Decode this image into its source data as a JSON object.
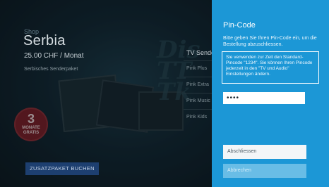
{
  "background": {
    "shop_label": "Shop",
    "title": "Serbia",
    "price": "25.00 CHF / Monat",
    "description": "Serbisches Senderpaket",
    "promo_badge": {
      "number": "3",
      "line1": "MONATE",
      "line2": "GRATIS"
    },
    "channel_list": {
      "header": "TV Sender",
      "items": [
        "Pink Plus",
        "Pink Extra",
        "Pink Music",
        "Pink Kids"
      ]
    },
    "book_button_label": "ZUSATZPAKET BUCHEN"
  },
  "dialog": {
    "title": "Pin-Code",
    "instruction": "Bitte geben Sie Ihren Pin-Code ein, um die Bestellung abzuschliessen.",
    "info": "Sie verwenden zur Zeit den Standard-Pincode \"1234\". Sie können Ihren Pincode jederzeit in den \"TV und Audio\" Einstellungen ändern.",
    "pin_value": "••••",
    "confirm_label": "Abschliessen",
    "cancel_label": "Abbrechen"
  },
  "colors": {
    "panel": "#1c97d6",
    "primary_button": "#1d3f70"
  }
}
